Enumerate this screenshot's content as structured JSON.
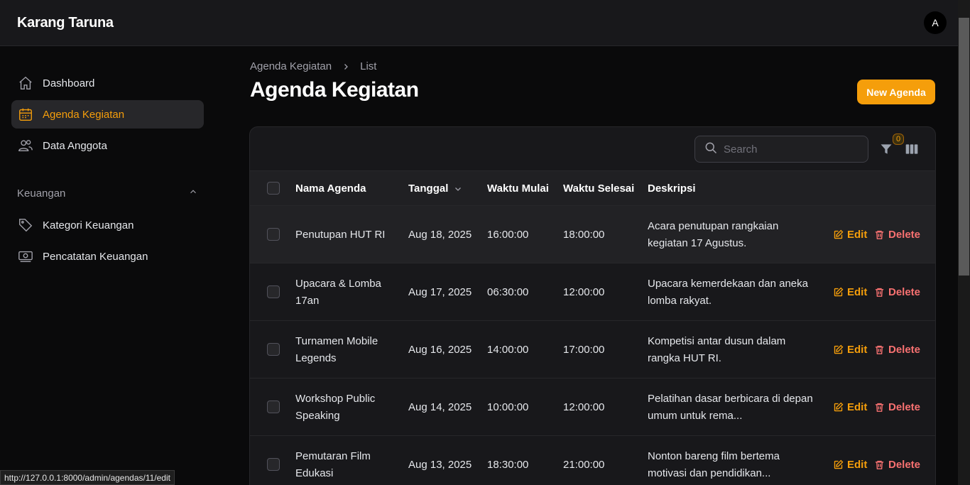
{
  "app": {
    "brand": "Karang Taruna",
    "avatar_initial": "A"
  },
  "sidebar": {
    "items": [
      {
        "label": "Dashboard",
        "icon": "home-icon",
        "active": false
      },
      {
        "label": "Agenda Kegiatan",
        "icon": "calendar-icon",
        "active": true
      },
      {
        "label": "Data Anggota",
        "icon": "users-icon",
        "active": false
      }
    ],
    "group": {
      "label": "Keuangan",
      "items": [
        {
          "label": "Kategori Keuangan",
          "icon": "tag-icon"
        },
        {
          "label": "Pencatatan Keuangan",
          "icon": "banknotes-icon"
        }
      ]
    }
  },
  "breadcrumb": {
    "parent": "Agenda Kegiatan",
    "current": "List"
  },
  "page": {
    "title": "Agenda Kegiatan",
    "new_button": "New Agenda"
  },
  "toolbar": {
    "search_placeholder": "Search",
    "filter_count": "0"
  },
  "table": {
    "columns": {
      "name": "Nama Agenda",
      "date": "Tanggal",
      "start": "Waktu Mulai",
      "end": "Waktu Selesai",
      "desc": "Deskripsi"
    },
    "actions": {
      "edit": "Edit",
      "delete": "Delete"
    },
    "rows": [
      {
        "name": "Penutupan HUT RI",
        "date": "Aug 18, 2025",
        "start": "16:00:00",
        "end": "18:00:00",
        "desc": "Acara penutupan rangkaian kegiatan 17 Agustus."
      },
      {
        "name": "Upacara & Lomba 17an",
        "date": "Aug 17, 2025",
        "start": "06:30:00",
        "end": "12:00:00",
        "desc": "Upacara kemerdekaan dan aneka lomba rakyat."
      },
      {
        "name": "Turnamen Mobile Legends",
        "date": "Aug 16, 2025",
        "start": "14:00:00",
        "end": "17:00:00",
        "desc": "Kompetisi antar dusun dalam rangka HUT RI."
      },
      {
        "name": "Workshop Public Speaking",
        "date": "Aug 14, 2025",
        "start": "10:00:00",
        "end": "12:00:00",
        "desc": "Pelatihan dasar berbicara di depan umum untuk rema..."
      },
      {
        "name": "Pemutaran Film Edukasi",
        "date": "Aug 13, 2025",
        "start": "18:30:00",
        "end": "21:00:00",
        "desc": "Nonton bareng film bertema motivasi dan pendidikan..."
      }
    ]
  },
  "statusbar": {
    "url": "http://127.0.0.1:8000/admin/agendas/11/edit"
  },
  "colors": {
    "accent": "#f59e0b",
    "danger": "#f87171",
    "background": "#0a0a0b",
    "panel": "#18181b"
  }
}
